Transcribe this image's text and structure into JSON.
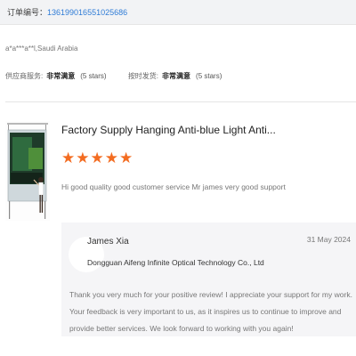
{
  "order": {
    "label": "订单编号：",
    "number": "136199016551025686"
  },
  "buyer": {
    "location": "a*a***a**l,Saudi Arabia"
  },
  "ratings": [
    {
      "label": "供应商服务:",
      "value": "非常满意",
      "stars": "(5 stars)"
    },
    {
      "label": "按时发货:",
      "value": "非常满意",
      "stars": "(5 stars)"
    }
  ],
  "review": {
    "product_title": "Factory Supply Hanging Anti-blue Light Anti...",
    "rating": 5,
    "star_color": "#f36c21",
    "text": "Hi good quality good customer service Mr james very good support"
  },
  "reply": {
    "name": "James Xia",
    "company": "Dongguan Aifeng Infinite Optical Technology Co., Ltd",
    "date": "31 May 2024",
    "text": "Thank you very much for your positive review! I appreciate your support for my work. Your feedback is very important to us, as it inspires us to continue to improve and provide better services. We look forward to working with you again!"
  },
  "colors": {
    "accent_link": "#2e7bd6",
    "reply_bg": "#f5f5f7"
  }
}
